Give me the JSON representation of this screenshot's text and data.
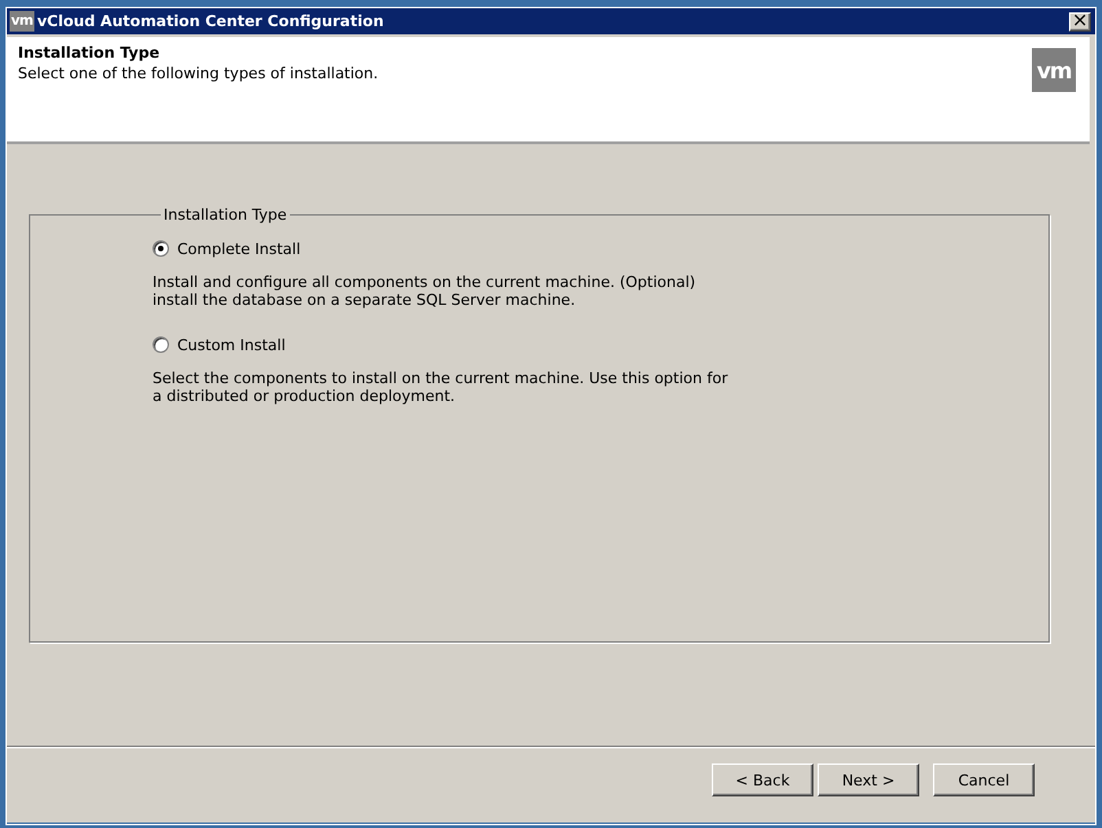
{
  "window": {
    "app_icon": "vm",
    "title": "vCloud Automation Center Configuration",
    "close": "×"
  },
  "header": {
    "title": "Installation Type",
    "subtitle": "Select one of the following types of installation.",
    "logo": "vm"
  },
  "group": {
    "title": "Installation Type",
    "options": [
      {
        "label": "Complete Install",
        "selected": true,
        "description": "Install and configure all components on the current machine. (Optional) install the database on a separate SQL Server machine."
      },
      {
        "label": "Custom Install",
        "selected": false,
        "description": "Select the components to install on the current machine. Use this option for a distributed or production deployment."
      }
    ]
  },
  "buttons": [
    {
      "label": "< Back"
    },
    {
      "label": "Next >"
    },
    {
      "label": "Cancel"
    }
  ]
}
